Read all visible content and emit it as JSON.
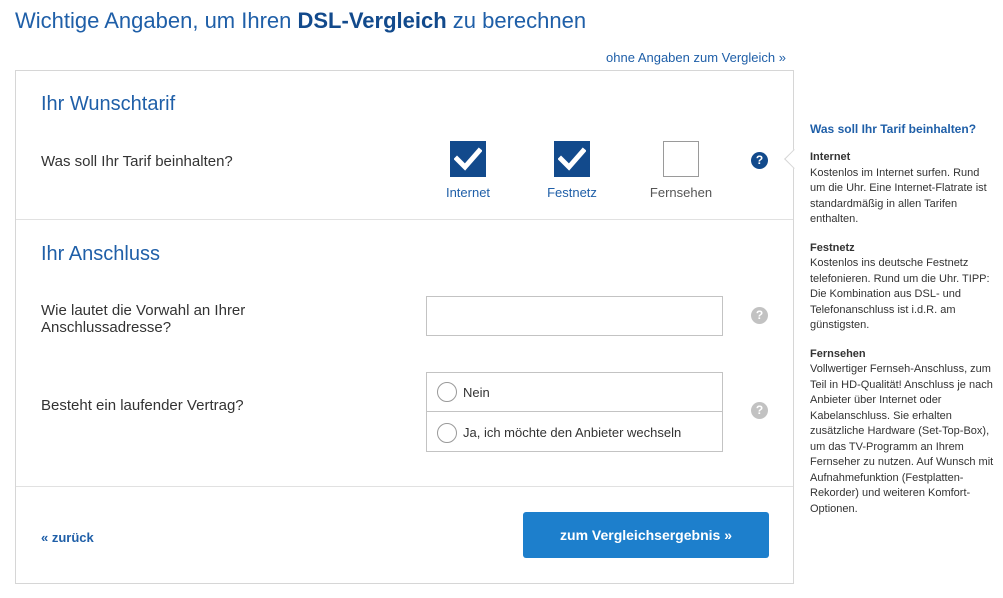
{
  "page": {
    "title_prefix": "Wichtige Angaben, um Ihren ",
    "title_emphasis": "DSL-Vergleich",
    "title_suffix": " zu berechnen",
    "skip_link": "ohne Angaben zum Vergleich »"
  },
  "wunschtarif": {
    "title": "Ihr Wunschtarif",
    "question": "Was soll Ihr Tarif beinhalten?",
    "options": [
      {
        "label": "Internet",
        "checked": true
      },
      {
        "label": "Festnetz",
        "checked": true
      },
      {
        "label": "Fernsehen",
        "checked": false
      }
    ],
    "help": "?"
  },
  "anschluss": {
    "title": "Ihr Anschluss",
    "vorwahl_question": "Wie lautet die Vorwahl an Ihrer Anschlussadresse?",
    "vorwahl_value": "",
    "vertrag_question": "Besteht ein laufender Vertrag?",
    "radio_options": [
      {
        "label": "Nein",
        "selected": false
      },
      {
        "label": "Ja, ich möchte den Anbieter wechseln",
        "selected": false
      }
    ],
    "help": "?"
  },
  "actions": {
    "back": "« zurück",
    "submit": "zum Vergleichsergebnis »"
  },
  "sidebar": {
    "title": "Was soll Ihr Tarif beinhalten?",
    "blocks": [
      {
        "heading": "Internet",
        "text": "Kostenlos im Internet surfen. Rund um die Uhr. Eine Internet-Flatrate ist standardmäßig in allen Tarifen enthalten."
      },
      {
        "heading": "Festnetz",
        "text": "Kostenlos ins deutsche Festnetz telefonieren. Rund um die Uhr. TIPP: Die Kombination aus DSL- und Telefonanschluss ist i.d.R. am günstigsten."
      },
      {
        "heading": "Fernsehen",
        "text": "Vollwertiger Fernseh-Anschluss, zum Teil in HD-Qualität! Anschluss je nach Anbieter über Internet oder Kabelanschluss. Sie erhalten zusätzliche Hardware (Set-Top-Box), um das TV-Programm an Ihrem Fernseher zu nutzen. Auf Wunsch mit Aufnahmefunktion (Festplatten-Rekorder) und weiteren Komfort-Optionen."
      }
    ]
  },
  "colors": {
    "brand_blue": "#124a8c",
    "link_blue": "#1f5fa8",
    "button_blue": "#1d7fcc"
  }
}
